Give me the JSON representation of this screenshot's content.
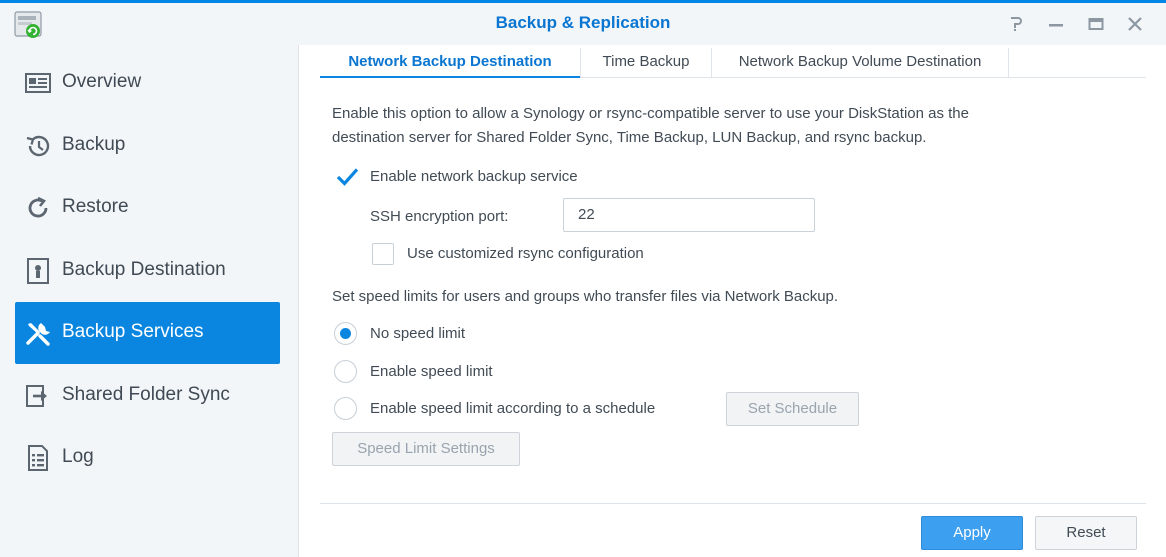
{
  "window": {
    "title": "Backup & Replication"
  },
  "window_controls": [
    "help-icon",
    "minimize-icon",
    "maximize-icon",
    "close-icon"
  ],
  "colors": {
    "accent": "#0a86e0",
    "title": "#0a76d1",
    "primary_button": "#3c9ff0"
  },
  "sidebar": {
    "items": [
      {
        "label": "Overview",
        "icon": "overview-icon",
        "active": false
      },
      {
        "label": "Backup",
        "icon": "backup-icon",
        "active": false
      },
      {
        "label": "Restore",
        "icon": "restore-icon",
        "active": false
      },
      {
        "label": "Backup Destination",
        "icon": "backup-destination-icon",
        "active": false
      },
      {
        "label": "Backup Services",
        "icon": "wrench-icon",
        "active": true
      },
      {
        "label": "Shared Folder Sync",
        "icon": "shared-folder-sync-icon",
        "active": false
      },
      {
        "label": "Log",
        "icon": "log-icon",
        "active": false
      }
    ]
  },
  "tabs": [
    {
      "label": "Network Backup Destination",
      "active": true
    },
    {
      "label": "Time Backup",
      "active": false
    },
    {
      "label": "Network Backup Volume Destination",
      "active": false
    }
  ],
  "main": {
    "description_line1": "Enable this option to allow a Synology or rsync-compatible server to use your DiskStation as the",
    "description_line2": "destination server for Shared Folder Sync, Time Backup, LUN Backup, and rsync backup.",
    "enable_service": {
      "label": "Enable network backup service",
      "checked": true
    },
    "ssh_port": {
      "label": "SSH encryption port:",
      "value": "22"
    },
    "custom_rsync": {
      "label": "Use customized rsync configuration",
      "checked": false
    },
    "speed_description": "Set speed limits for users and groups who transfer files via Network Backup.",
    "speed_options": [
      {
        "label": "No speed limit",
        "selected": true
      },
      {
        "label": "Enable speed limit",
        "selected": false
      },
      {
        "label": "Enable speed limit according to a schedule",
        "selected": false
      }
    ],
    "set_schedule_label": "Set Schedule",
    "speed_limit_settings_label": "Speed Limit Settings"
  },
  "footer": {
    "apply_label": "Apply",
    "reset_label": "Reset"
  }
}
